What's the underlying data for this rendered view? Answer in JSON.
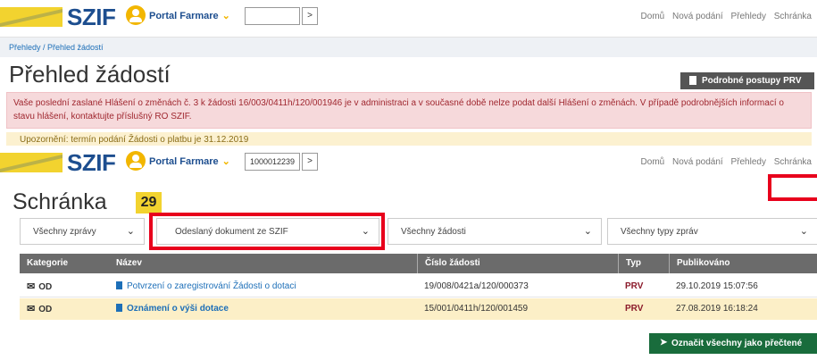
{
  "header_top": {
    "logo": "SZIF",
    "portal_label": "Portal Farmare",
    "input_value": "",
    "nav": [
      "Domů",
      "Nová podání",
      "Přehledy",
      "Schránka"
    ]
  },
  "breadcrumb": "Přehledy / Přehled žádostí",
  "page_title": "Přehled žádostí",
  "prv_button": "Podrobné postupy PRV",
  "alert_text": "Vaše poslední zaslané Hlášení o změnách č. 3 k žádosti 16/003/0411h/120/001946 je v administraci a v současné době nelze podat další Hlášení o změnách. V případě podrobnějších informací o stavu hlášení, kontaktujte příslušný RO SZIF.",
  "warning_text": "Upozornění: termín podání Žádosti o platbu je 31.12.2019",
  "header_bottom": {
    "logo": "SZIF",
    "portal_label": "Portal Farmare",
    "input_value": "1000012239",
    "nav": [
      "Domů",
      "Nová podání",
      "Přehledy",
      "Schránka"
    ]
  },
  "inbox": {
    "title": "Schránka",
    "count": "29",
    "filters": [
      "Všechny zprávy",
      "Odeslaný dokument ze SZIF",
      "Všechny žádosti",
      "Všechny typy zpráv"
    ],
    "columns": [
      "Kategorie",
      "Název",
      "Číslo žádosti",
      "Typ",
      "Publikováno"
    ],
    "rows": [
      {
        "category": "OD",
        "name": "Potvrzení o zaregistrování Žádosti o dotaci",
        "number": "19/008/0421a/120/000373",
        "type": "PRV",
        "published": "29.10.2019 15:07:56"
      },
      {
        "category": "OD",
        "name": "Oznámení o výši dotace",
        "number": "15/001/0411h/120/001459",
        "type": "PRV",
        "published": "27.08.2019 16:18:24"
      }
    ],
    "mark_all_button": "Označit všechny jako přečtené"
  },
  "colors": {
    "brand_blue": "#1d4e8f",
    "brand_yellow": "#f2b600",
    "highlight_red": "#e8001c",
    "action_green": "#196c3c"
  }
}
